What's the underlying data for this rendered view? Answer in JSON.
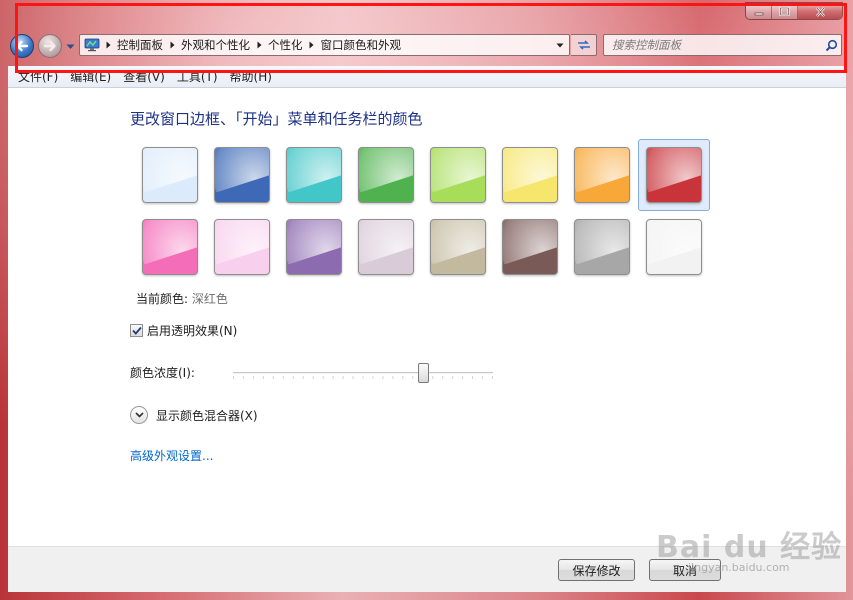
{
  "window": {
    "controls": [
      "minimize",
      "maximize",
      "close"
    ]
  },
  "nav": {
    "breadcrumbs": [
      "控制面板",
      "外观和个性化",
      "个性化",
      "窗口颜色和外观"
    ],
    "search_placeholder": "搜索控制面板"
  },
  "menu": {
    "items": [
      "文件(F)",
      "编辑(E)",
      "查看(V)",
      "工具(T)",
      "帮助(H)"
    ]
  },
  "main": {
    "heading": "更改窗口边框、「开始」菜单和任务栏的颜色",
    "swatches": [
      {
        "color": "#dcebfb"
      },
      {
        "color": "#3d69b6"
      },
      {
        "color": "#43c6c8"
      },
      {
        "color": "#4fb24f"
      },
      {
        "color": "#a8dd5a"
      },
      {
        "color": "#f6e66d"
      },
      {
        "color": "#f7a838"
      },
      {
        "color": "#c8343a"
      },
      {
        "color": "#f46db9"
      },
      {
        "color": "#f8cfec"
      },
      {
        "color": "#8d6bb0"
      },
      {
        "color": "#dacbd9"
      },
      {
        "color": "#c3b99e"
      },
      {
        "color": "#7a5a57"
      },
      {
        "color": "#a7a7a7"
      },
      {
        "color": "#f2f2f2"
      }
    ],
    "selected_index": 7,
    "current_color_label": "当前颜色:",
    "current_color_value": "深红色",
    "transparency_label": "启用透明效果(N)",
    "transparency_checked": true,
    "intensity_label": "颜色浓度(I):",
    "intensity_value": 0.73,
    "mixer_label": "显示颜色混合器(X)",
    "advanced_link": "高级外观设置..."
  },
  "footer": {
    "save_label": "保存修改",
    "cancel_label": "取消"
  },
  "watermark": {
    "text": "Bai du 经验",
    "url": "jingyan.baidu.com"
  },
  "colors": {
    "heading": "#1e3287",
    "link": "#0066cc",
    "annotation": "#ff1414",
    "selected_border": "#84acdd"
  }
}
